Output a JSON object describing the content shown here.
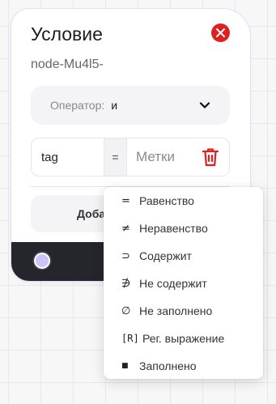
{
  "node": {
    "title": "Условие",
    "id_text": "node-Mu4l5-",
    "operator_label": "Оператор:",
    "operator_value": "и",
    "condition": {
      "field_value": "tag",
      "operator_symbol": "=",
      "value_placeholder": "Метки"
    },
    "add_button_label": "Добавить условие"
  },
  "dropdown": {
    "items": [
      {
        "symbol": "=",
        "label": "Равенство"
      },
      {
        "symbol": "≠",
        "label": "Неравенство"
      },
      {
        "symbol": "⊃",
        "label": "Содержит"
      },
      {
        "symbol": "∌",
        "label": "Не содержит"
      },
      {
        "symbol": "∅",
        "label": "Не заполнено"
      },
      {
        "symbol": "[R]",
        "label": "Рег. выражение"
      },
      {
        "symbol": "■",
        "label": "Заполнено"
      }
    ]
  },
  "icons": {
    "close": "close-icon",
    "chevron": "chevron-down-icon",
    "trash": "trash-icon"
  },
  "colors": {
    "accent_red": "#e02020",
    "footer": "#25262b",
    "handle": "#cfc2ff"
  }
}
